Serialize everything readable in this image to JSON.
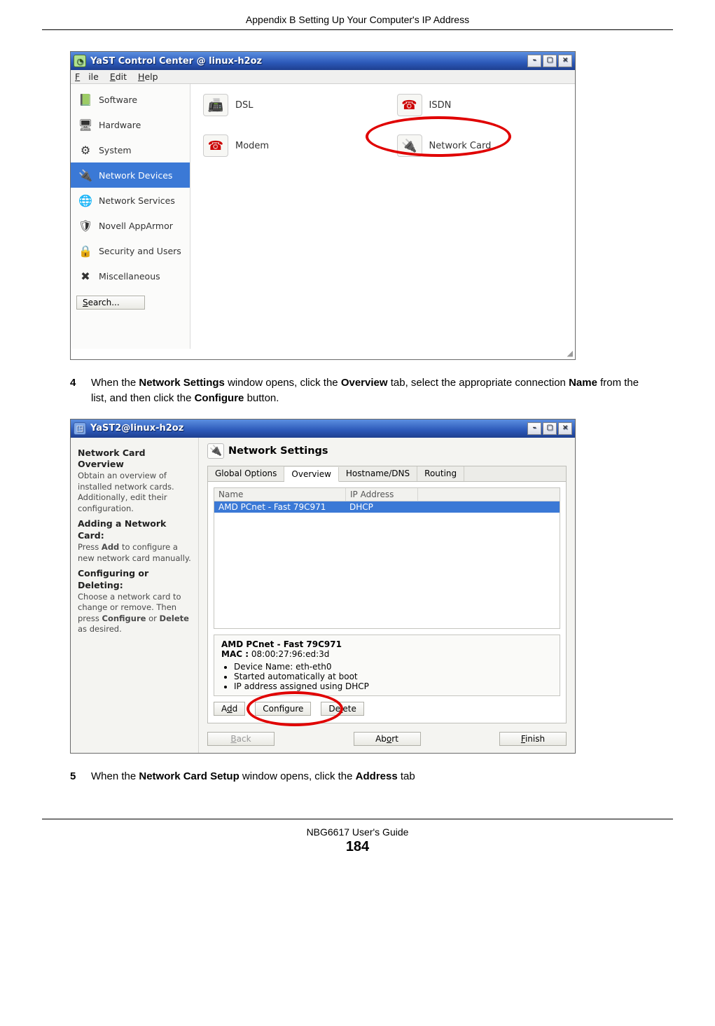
{
  "doc": {
    "header": "Appendix B Setting Up Your Computer's IP Address",
    "footer_guide": "NBG6617 User's Guide",
    "page_number": "184"
  },
  "step4": {
    "num": "4",
    "text_pre": "When the ",
    "b1": "Network Settings",
    "text_mid1": " window opens, click the ",
    "b2": "Overview",
    "text_mid2": " tab, select the appropriate connection ",
    "b3": "Name",
    "text_mid3": " from the list, and then click the ",
    "b4": "Configure",
    "text_post": " button."
  },
  "step5": {
    "num": "5",
    "text_pre": "When the ",
    "b1": "Network Card Setup",
    "text_mid": " window opens, click the ",
    "b2": "Address",
    "text_post": " tab"
  },
  "win1": {
    "title": "YaST Control Center @ linux-h2oz",
    "menu": {
      "file": "File",
      "edit": "Edit",
      "help": "Help"
    },
    "sidebar": [
      {
        "label": "Software",
        "icon": "📗"
      },
      {
        "label": "Hardware",
        "icon": "🖥"
      },
      {
        "label": "System",
        "icon": "⚙"
      },
      {
        "label": "Network Devices",
        "icon": "🔌",
        "selected": true
      },
      {
        "label": "Network Services",
        "icon": "🌐"
      },
      {
        "label": "Novell AppArmor",
        "icon": "🛡"
      },
      {
        "label": "Security and Users",
        "icon": "🔒"
      },
      {
        "label": "Miscellaneous",
        "icon": "✖"
      }
    ],
    "search_label": "Search...",
    "devices": {
      "dsl": {
        "label": "DSL",
        "icon": "📠"
      },
      "isdn": {
        "label": "ISDN",
        "icon": "☎"
      },
      "modem": {
        "label": "Modem",
        "icon": "☎"
      },
      "netcard": {
        "label": "Network Card",
        "icon": "🔌"
      }
    }
  },
  "win2": {
    "title": "YaST2@linux-h2oz",
    "help": {
      "h1": "Network Card Overview",
      "p1": "Obtain an overview of installed network cards. Additionally, edit their configuration.",
      "h2": "Adding a Network Card:",
      "p2_pre": "Press ",
      "p2_b": "Add",
      "p2_post": " to configure a new network card manually.",
      "h3": "Configuring or Deleting:",
      "p3_pre": "Choose a network card to change or remove. Then press ",
      "p3_b1": "Configure",
      "p3_mid": " or ",
      "p3_b2": "Delete",
      "p3_post": " as desired."
    },
    "panel_title": "Network Settings",
    "tabs": {
      "global": "Global Options",
      "overview": "Overview",
      "hostdns": "Hostname/DNS",
      "routing": "Routing"
    },
    "list": {
      "col_name": "Name",
      "col_ip": "IP Address",
      "row_name": "AMD PCnet - Fast 79C971",
      "row_ip": "DHCP"
    },
    "detail": {
      "title": "AMD PCnet - Fast 79C971",
      "mac_label": "MAC :",
      "mac_value": "08:00:27:96:ed:3d",
      "li1": "Device Name: eth-eth0",
      "li2": "Started automatically at boot",
      "li3": "IP address assigned using DHCP"
    },
    "buttons": {
      "add": "Add",
      "configure": "Configure",
      "delete": "Delete",
      "back": "Back",
      "abort": "Abort",
      "finish": "Finish"
    }
  }
}
